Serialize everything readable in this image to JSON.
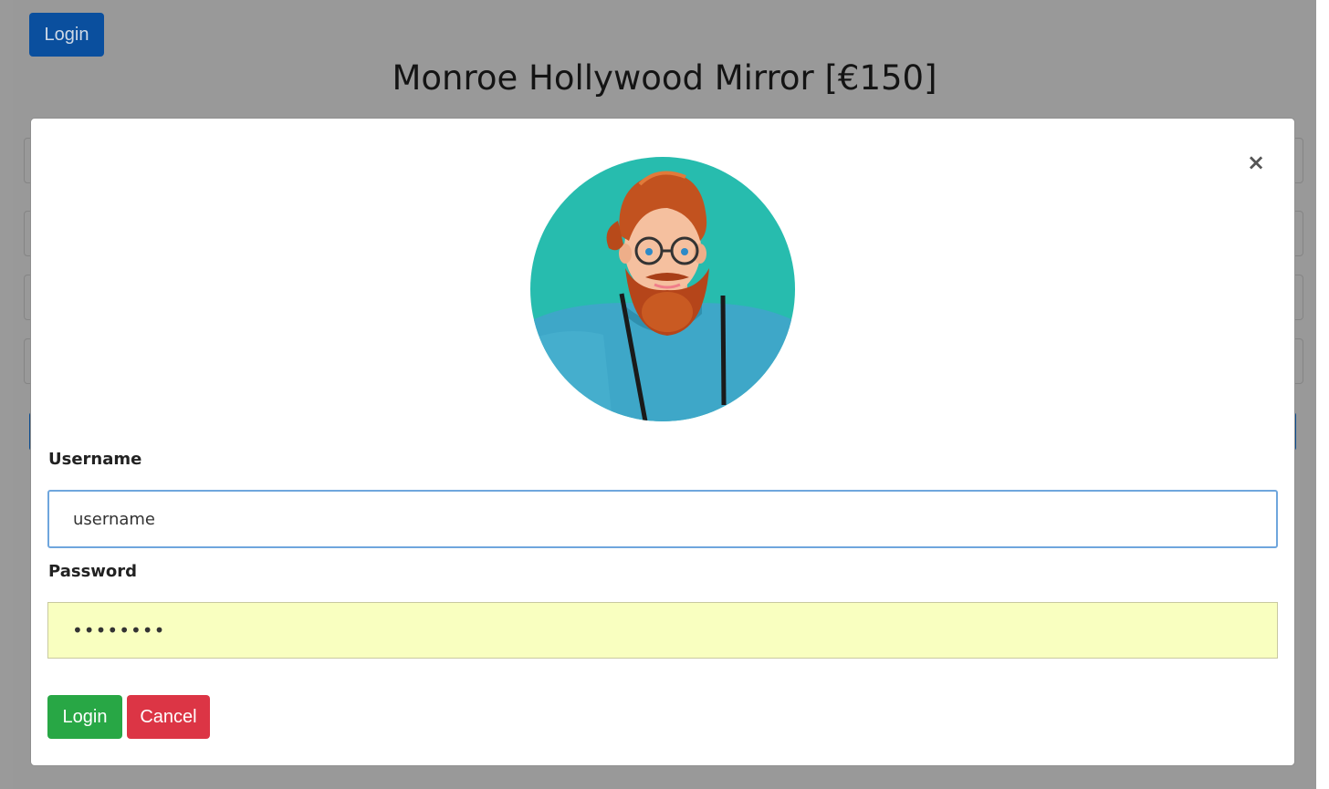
{
  "header": {
    "login_label": "Login",
    "title": "Monroe Hollywood Mirror [€150]"
  },
  "modal": {
    "close_symbol": "×",
    "avatar_icon": "bearded-man-avatar",
    "username_label": "Username",
    "username_value": "username",
    "password_label": "Password",
    "password_value": "••••••••",
    "login_label": "Login",
    "cancel_label": "Cancel"
  },
  "colors": {
    "primary": "#0a4f9e",
    "success": "#28a745",
    "danger": "#dc3545",
    "autofill": "#f9ffc0"
  }
}
